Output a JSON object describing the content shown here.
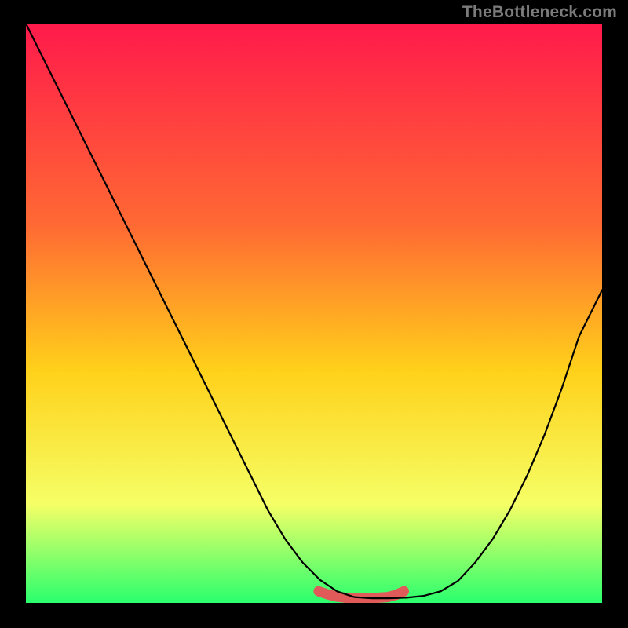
{
  "watermark": "TheBottleneck.com",
  "colors": {
    "frame": "#000000",
    "gradient_top": "#ff1a4b",
    "gradient_upper": "#ff6a33",
    "gradient_mid": "#ffd11a",
    "gradient_lower": "#f5ff66",
    "gradient_bottom": "#2aff6e",
    "curve": "#000000",
    "marker_fill": "#e05a5a",
    "marker_stroke": "#d24646"
  },
  "chart_data": {
    "type": "line",
    "title": "",
    "xlabel": "",
    "ylabel": "",
    "xlim": [
      0,
      100
    ],
    "ylim": [
      0,
      100
    ],
    "grid": false,
    "legend": false,
    "x": [
      0,
      3,
      6,
      9,
      12,
      15,
      18,
      21,
      24,
      27,
      30,
      33,
      36,
      39,
      42,
      45,
      48,
      51,
      54,
      57,
      60,
      63,
      66,
      69,
      72,
      75,
      78,
      81,
      84,
      87,
      90,
      93,
      96,
      100
    ],
    "y": [
      100,
      94,
      88,
      82,
      76,
      70,
      64,
      58,
      52,
      46,
      40,
      34,
      28,
      22,
      16,
      11,
      7,
      4,
      2,
      1,
      0.8,
      0.8,
      0.9,
      1.2,
      2,
      3.8,
      7,
      11,
      16,
      22,
      29,
      37,
      46,
      54
    ],
    "marker_region": {
      "x": [
        50.8,
        52.3,
        53.8,
        55.3,
        56.8,
        58.3,
        59.8,
        61.3,
        62.8,
        64.3,
        65.6
      ],
      "y": [
        2.0,
        1.5,
        1.1,
        0.9,
        0.8,
        0.8,
        0.8,
        0.9,
        1.0,
        1.4,
        2.0
      ]
    },
    "annotations": []
  }
}
